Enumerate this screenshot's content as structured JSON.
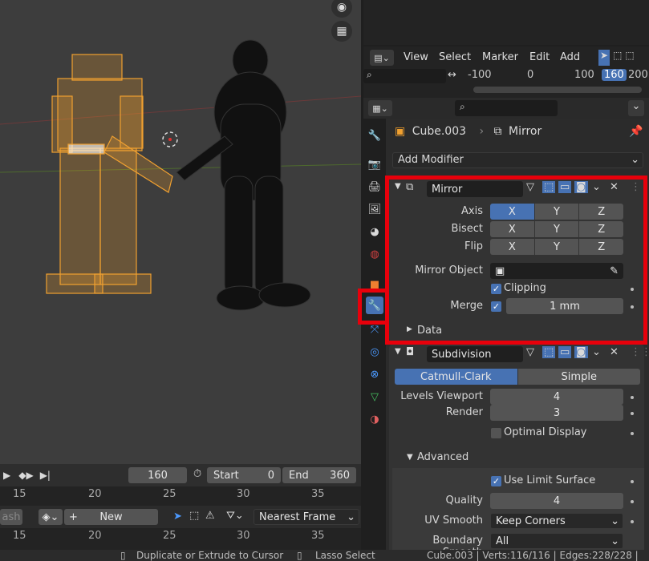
{
  "dopesheet": {
    "menus": [
      "View",
      "Select",
      "Marker",
      "Edit",
      "Add"
    ],
    "ruler": [
      "-100",
      "0",
      "100",
      "160",
      "200"
    ]
  },
  "properties": {
    "breadcrumb_object": "Cube.003",
    "breadcrumb_modifier": "Mirror",
    "add_modifier_label": "Add Modifier",
    "mirror": {
      "name": "Mirror",
      "axis_label": "Axis",
      "bisect_label": "Bisect",
      "flip_label": "Flip",
      "axes": [
        "X",
        "Y",
        "Z"
      ],
      "mirror_object_label": "Mirror Object",
      "clipping_label": "Clipping",
      "merge_label": "Merge",
      "merge_value": "1 mm",
      "data_label": "Data"
    },
    "subdivision": {
      "name": "Subdivision",
      "tab_catmull": "Catmull-Clark",
      "tab_simple": "Simple",
      "levels_viewport_label": "Levels Viewport",
      "levels_viewport_value": "4",
      "render_label": "Render",
      "render_value": "3",
      "optimal_display_label": "Optimal Display",
      "advanced_label": "Advanced",
      "use_limit_surface_label": "Use Limit Surface",
      "quality_label": "Quality",
      "quality_value": "4",
      "uv_smooth_label": "UV Smooth",
      "uv_smooth_value": "Keep Corners",
      "boundary_smooth_label": "Boundary Smooth",
      "boundary_smooth_value": "All"
    }
  },
  "timeline": {
    "current_frame": "160",
    "start_label": "Start",
    "start_value": "0",
    "end_label": "End",
    "end_value": "360",
    "ruler": [
      "15",
      "20",
      "25",
      "30",
      "35"
    ],
    "keying_partial": "ash",
    "new_label": "New",
    "snap_label": "Nearest Frame"
  },
  "statusbar": {
    "hint1": "Duplicate or Extrude to Cursor",
    "hint2": "Lasso Select",
    "stats": "Cube.003 | Verts:116/116 | Edges:228/228 |"
  },
  "colors": {
    "accent": "#4772b3",
    "selected_mesh": "#f0a030",
    "highlight": "#e8000b"
  }
}
